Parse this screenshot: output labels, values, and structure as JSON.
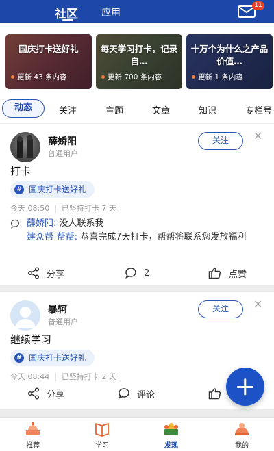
{
  "header": {
    "tabs": [
      "社区",
      "应用"
    ],
    "active_tab": "社区",
    "mail_badge": "11",
    "brand_color": "#1d47a8"
  },
  "banners": [
    {
      "title": "国庆打卡送好礼",
      "meta": "更新 43 条内容"
    },
    {
      "title": "每天学习打卡，记录自…",
      "meta": "更新 700 条内容"
    },
    {
      "title": "十万个为什么之产品价值…",
      "meta": "更新 1 条内容"
    }
  ],
  "filters": [
    "动态",
    "关注",
    "主题",
    "文章",
    "知识",
    "专栏号"
  ],
  "active_filter": "动态",
  "posts": [
    {
      "username": "薛娇阳",
      "user_type": "普通用户",
      "follow_label": "关注",
      "text": "打卡",
      "topic": "国庆打卡送好礼",
      "time": "今天 08:50",
      "streak": "已坚持打卡 7 天",
      "comments": [
        {
          "author": "薛娇阳:",
          "text": " 没人联系我"
        },
        {
          "author": "建众帮-帮帮:",
          "text": " 恭喜完成7天打卡，帮帮将联系您发放福利"
        }
      ],
      "share_label": "分享",
      "comment_count": "2",
      "like_label": "点赞"
    },
    {
      "username": "暴轲",
      "user_type": "普通用户",
      "follow_label": "关注",
      "text": "继续学习",
      "topic": "国庆打卡送好礼",
      "time": "今天 08:44",
      "streak": "已坚持打卡 2 天",
      "share_label": "分享",
      "comment_label": "评论",
      "like_label": "点赞"
    }
  ],
  "bottom_nav": [
    {
      "label": "推荐",
      "icon": "recommend-icon"
    },
    {
      "label": "学习",
      "icon": "study-icon"
    },
    {
      "label": "发现",
      "icon": "discover-icon"
    },
    {
      "label": "我的",
      "icon": "profile-icon"
    }
  ],
  "active_nav": "发现"
}
